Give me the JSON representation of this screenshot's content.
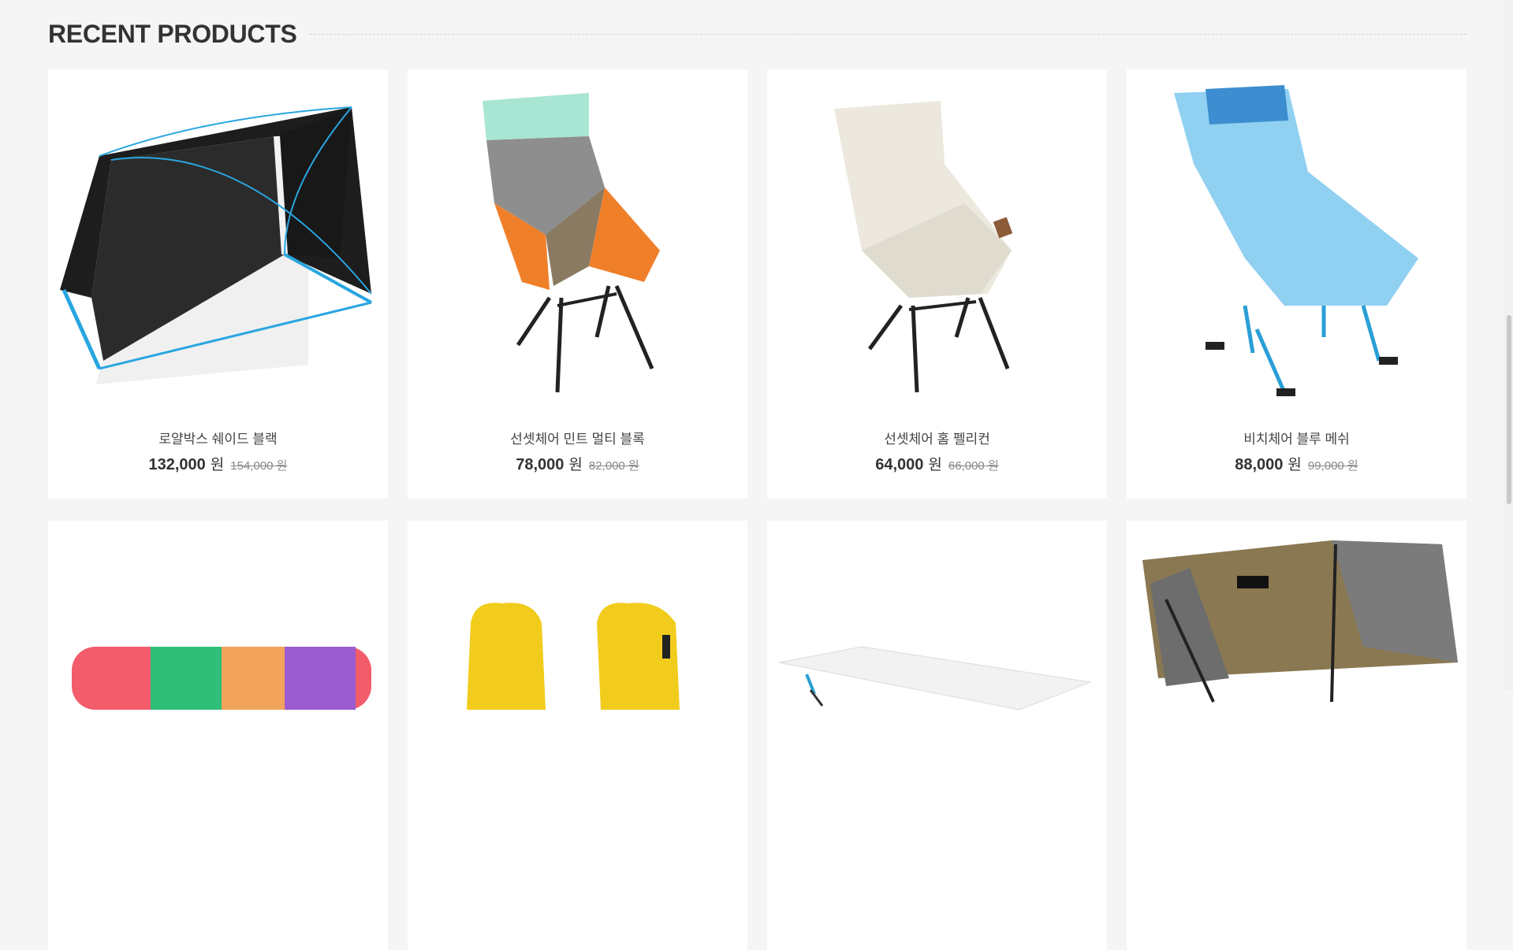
{
  "section": {
    "title": "RECENT PRODUCTS"
  },
  "products": [
    {
      "name": "로얄박스 쉐이드 블랙",
      "price": "132,000",
      "currency": "원",
      "old_price": "154,000 원",
      "icon": "shade-tent-image"
    },
    {
      "name": "선셋체어 민트 멀티 블록",
      "price": "78,000",
      "currency": "원",
      "old_price": "82,000 원",
      "icon": "mint-chair-image"
    },
    {
      "name": "선셋체어 홈 펠리컨",
      "price": "64,000",
      "currency": "원",
      "old_price": "66,000 원",
      "icon": "beige-chair-image"
    },
    {
      "name": "비치체어 블루 메쉬",
      "price": "88,000",
      "currency": "원",
      "old_price": "99,000 원",
      "icon": "blue-mesh-chair-image"
    },
    {
      "icon": "patterned-mat-image"
    },
    {
      "icon": "yellow-gloves-image"
    },
    {
      "icon": "white-cot-image"
    },
    {
      "icon": "olive-chair-image"
    }
  ],
  "colors": {
    "background": "#f5f5f5",
    "card": "#ffffff",
    "text": "#333333",
    "strike": "#888888"
  }
}
